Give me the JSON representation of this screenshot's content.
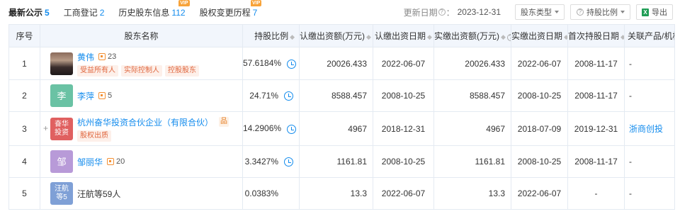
{
  "tabs": [
    {
      "label": "最新公示",
      "count": "5",
      "vip": ""
    },
    {
      "label": "工商登记",
      "count": "2",
      "vip": ""
    },
    {
      "label": "历史股东信息",
      "count": "112",
      "vip": "VIP"
    },
    {
      "label": "股权变更历程",
      "count": "7",
      "vip": "VIP"
    }
  ],
  "toolbar": {
    "update_label": "更新日期",
    "update_suffix": "：",
    "update_date": "2023-12-31",
    "type_label": "股东类型",
    "ratio_label": "持股比例",
    "export_label": "导出",
    "export_icon_text": "X"
  },
  "table": {
    "headers": {
      "index": "序号",
      "name": "股东名称",
      "ratio": "持股比例",
      "subscribed": "认缴出资额(万元)",
      "subscribed_date": "认缴出资日期",
      "paid": "实缴出资额(万元)",
      "paid_date": "实缴出资日期",
      "first_date": "首次持股日期",
      "related": "关联产品/机构"
    },
    "rows": [
      {
        "index": "1",
        "name": "黄伟",
        "avatar_text": "",
        "avatar_color": "#5a4a48",
        "rel_count": "23",
        "tags": [
          "受益所有人",
          "实际控制人",
          "控股股东"
        ],
        "ratio": "57.6184%",
        "subscribed": "20026.433",
        "subscribed_date": "2022-06-07",
        "paid": "20026.433",
        "paid_date": "2022-06-07",
        "first_date": "2008-11-17",
        "related": "-"
      },
      {
        "index": "2",
        "name": "李萍",
        "avatar_text": "李",
        "avatar_color": "#6ac2a4",
        "rel_count": "5",
        "tags": [],
        "ratio": "24.71%",
        "subscribed": "8588.457",
        "subscribed_date": "2008-10-25",
        "paid": "8588.457",
        "paid_date": "2008-10-25",
        "first_date": "2008-11-17",
        "related": "-"
      },
      {
        "index": "3",
        "name": "杭州奋华投资合伙企业（有限合伙）",
        "avatar_text": "奋华\n投资",
        "avatar_color": "#e06060",
        "rel_count": "",
        "tags": [
          "股权出质"
        ],
        "expand": "+",
        "corp_icon": "品",
        "ratio": "14.2906%",
        "subscribed": "4967",
        "subscribed_date": "2018-12-31",
        "paid": "4967",
        "paid_date": "2018-07-09",
        "first_date": "2019-12-31",
        "related": "浙商创投"
      },
      {
        "index": "4",
        "name": "邹丽华",
        "avatar_text": "邹",
        "avatar_color": "#b89ad8",
        "rel_count": "20",
        "tags": [],
        "ratio": "3.3427%",
        "subscribed": "1161.81",
        "subscribed_date": "2008-10-25",
        "paid": "1161.81",
        "paid_date": "2008-10-25",
        "first_date": "2008-11-17",
        "related": "-"
      },
      {
        "index": "5",
        "name": "汪航等59人",
        "avatar_text": "汪航\n等5",
        "avatar_color": "#7fa0d6",
        "rel_count": "",
        "tags": [],
        "ratio": "0.0383%",
        "subscribed": "13.3",
        "subscribed_date": "2022-06-07",
        "paid": "13.3",
        "paid_date": "2022-06-07",
        "first_date": "-",
        "related": "-"
      }
    ]
  },
  "colors": {
    "link": "#128bed",
    "tag_bg": "#fdf0ea",
    "tag_text": "#e0663e",
    "header_bg": "#f2f6fc",
    "vip_bg": "#f7a33a"
  },
  "icons": [
    "history-clock-icon",
    "relation-count-icon",
    "question-icon",
    "excel-icon",
    "caret-down-icon",
    "structure-icon"
  ]
}
